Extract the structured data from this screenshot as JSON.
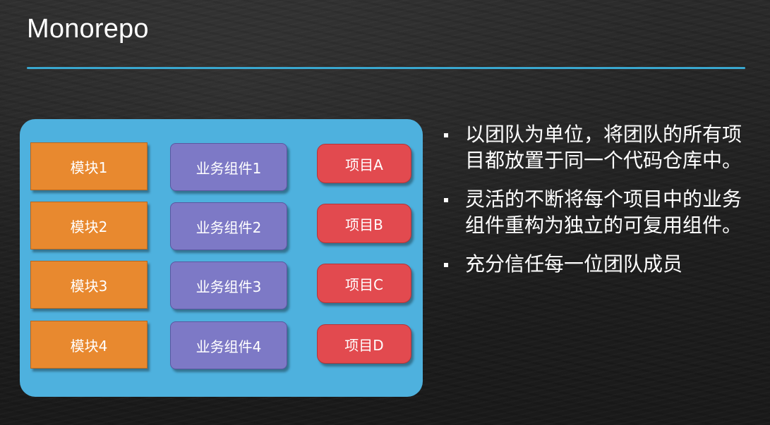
{
  "slide": {
    "title": "Monorepo",
    "accent_color": "#39a7cf"
  },
  "diagram": {
    "panel_color": "#4eb1de",
    "modules": [
      "模块1",
      "模块2",
      "模块3",
      "模块4"
    ],
    "components": [
      "业务组件1",
      "业务组件2",
      "业务组件3",
      "业务组件4"
    ],
    "projects": [
      "项目A",
      "项目B",
      "项目C",
      "项目D"
    ],
    "colors": {
      "module": "#e8892f",
      "component": "#7d79c6",
      "project": "#e24a4f"
    }
  },
  "bullets": [
    "以团队为单位，将团队的所有项目都放置于同一个代码仓库中。",
    "灵活的不断将每个项目中的业务组件重构为独立的可复用组件。",
    "充分信任每一位团队成员"
  ]
}
